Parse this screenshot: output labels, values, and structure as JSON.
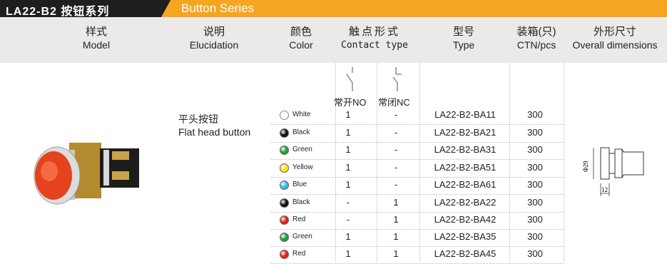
{
  "title_bar": {
    "left_title": "LA22-B2 按钮系列",
    "right_title": "Button Series"
  },
  "headers": {
    "model_zh": "样式",
    "model_en": "Model",
    "elucidation_zh": "说明",
    "elucidation_en": "Elucidation",
    "color_zh": "颜色",
    "color_en": "Color",
    "contact_zh": "触点形式",
    "contact_en": "Contact type",
    "type_zh": "型号",
    "type_en": "Type",
    "ctn_zh": "装箱(只)",
    "ctn_en": "CTN/pcs",
    "dims_zh": "外形尺寸",
    "dims_en": "Overall dimensions"
  },
  "contact_labels": {
    "no": "常开NO",
    "nc": "常闭NC"
  },
  "elucidation": {
    "zh": "平头按钮",
    "en": "Flat head button"
  },
  "dimensions": {
    "diameter": "Φ29",
    "length": "12"
  },
  "rows": [
    {
      "color": "White",
      "hex": "#ffffff",
      "no": "1",
      "nc": "-",
      "type": "LA22-B2-BA11",
      "ctn": "300"
    },
    {
      "color": "Black",
      "hex": "#111111",
      "no": "1",
      "nc": "-",
      "type": "LA22-B2-BA21",
      "ctn": "300"
    },
    {
      "color": "Green",
      "hex": "#1f9e3a",
      "no": "1",
      "nc": "-",
      "type": "LA22-B2-BA31",
      "ctn": "300"
    },
    {
      "color": "Yellow",
      "hex": "#f2e21c",
      "no": "1",
      "nc": "-",
      "type": "LA22-B2-BA51",
      "ctn": "300"
    },
    {
      "color": "Blue",
      "hex": "#3cb6e8",
      "no": "1",
      "nc": "-",
      "type": "LA22-B2-BA61",
      "ctn": "300"
    },
    {
      "color": "Black",
      "hex": "#111111",
      "no": "-",
      "nc": "1",
      "type": "LA22-B2-BA22",
      "ctn": "300"
    },
    {
      "color": "Red",
      "hex": "#e0231e",
      "no": "-",
      "nc": "1",
      "type": "LA22-B2-BA42",
      "ctn": "300"
    },
    {
      "color": "Green",
      "hex": "#1f9e3a",
      "no": "1",
      "nc": "1",
      "type": "LA22-B2-BA35",
      "ctn": "300"
    },
    {
      "color": "Red",
      "hex": "#e0231e",
      "no": "1",
      "nc": "1",
      "type": "LA22-B2-BA45",
      "ctn": "300"
    }
  ]
}
